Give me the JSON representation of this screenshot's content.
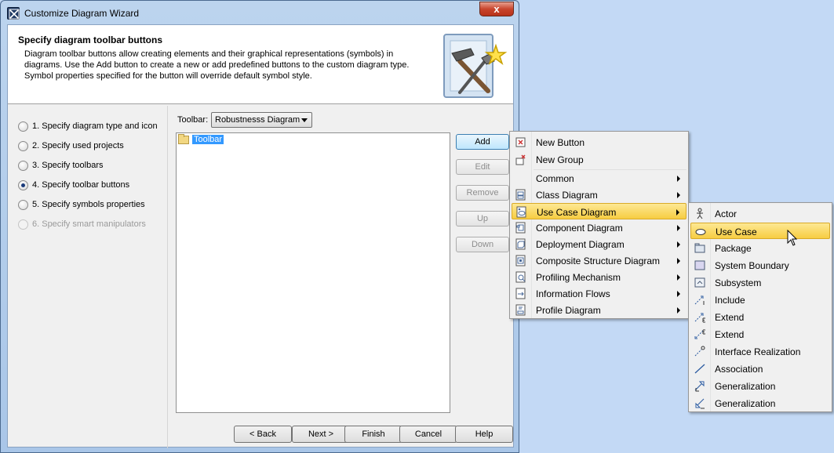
{
  "window": {
    "title": "Customize Diagram Wizard",
    "close_glyph": "x"
  },
  "header": {
    "title": "Specify diagram toolbar buttons",
    "description_lines": [
      "Diagram toolbar buttons allow creating elements and their graphical representations (symbols) in",
      "diagrams. Use the Add button to create a new or add predefined buttons to the custom diagram type.",
      "Symbol properties specified for the button will override default symbol style."
    ]
  },
  "steps": [
    {
      "label": "1. Specify diagram type and icon",
      "state": "unchecked"
    },
    {
      "label": "2. Specify used projects",
      "state": "unchecked"
    },
    {
      "label": "3. Specify toolbars",
      "state": "unchecked"
    },
    {
      "label": "4. Specify toolbar buttons",
      "state": "checked"
    },
    {
      "label": "5. Specify symbols properties",
      "state": "unchecked"
    },
    {
      "label": "6. Specify smart manipulators",
      "state": "disabled"
    }
  ],
  "toolbar": {
    "label": "Toolbar:",
    "selected": "Robustnesss Diagram"
  },
  "tree": {
    "root": "Toolbar"
  },
  "side_buttons": [
    "Add",
    "Edit",
    "Remove",
    "Up",
    "Down"
  ],
  "footer_buttons": [
    "< Back",
    "Next >",
    "Finish",
    "Cancel",
    "Help"
  ],
  "add_menu": {
    "items": [
      {
        "label": "New Button",
        "icon": "new-button-icon",
        "submenu": false
      },
      {
        "label": "New Group",
        "icon": "new-group-icon",
        "submenu": false
      },
      {
        "label": "Common",
        "icon": "",
        "submenu": true
      },
      {
        "label": "Class Diagram",
        "icon": "class-diagram-icon",
        "submenu": true
      },
      {
        "label": "Use Case Diagram",
        "icon": "use-case-diagram-icon",
        "submenu": true
      },
      {
        "label": "Component Diagram",
        "icon": "component-diagram-icon",
        "submenu": true
      },
      {
        "label": "Deployment Diagram",
        "icon": "deployment-diagram-icon",
        "submenu": true
      },
      {
        "label": "Composite Structure Diagram",
        "icon": "composite-structure-diagram-icon",
        "submenu": true
      },
      {
        "label": "Profiling Mechanism",
        "icon": "profiling-mechanism-icon",
        "submenu": true
      },
      {
        "label": "Information Flows",
        "icon": "information-flows-icon",
        "submenu": true
      },
      {
        "label": "Profile Diagram",
        "icon": "profile-diagram-icon",
        "submenu": true
      }
    ]
  },
  "use_case_menu": {
    "items": [
      {
        "label": "Actor",
        "icon": "actor-icon"
      },
      {
        "label": "Use Case",
        "icon": "use-case-icon"
      },
      {
        "label": "Package",
        "icon": "package-icon"
      },
      {
        "label": "System Boundary",
        "icon": "system-boundary-icon"
      },
      {
        "label": "Subsystem",
        "icon": "subsystem-icon"
      },
      {
        "label": "Include",
        "icon": "include-icon"
      },
      {
        "label": "Extend",
        "icon": "extend-icon"
      },
      {
        "label": "Extend",
        "icon": "extend-icon"
      },
      {
        "label": "Interface Realization",
        "icon": "interface-realization-icon"
      },
      {
        "label": "Association",
        "icon": "association-icon"
      },
      {
        "label": "Generalization",
        "icon": "generalization-icon"
      },
      {
        "label": "Generalization",
        "icon": "generalization-icon"
      }
    ]
  },
  "colors": {
    "highlight": "#f7cd42",
    "selection": "#3399ff",
    "desktop": "#c3d9f5"
  }
}
